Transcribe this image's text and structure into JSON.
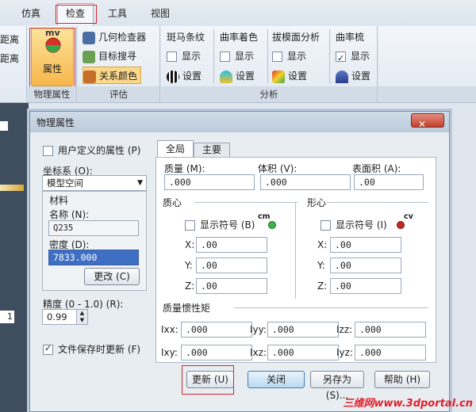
{
  "tabs": [
    "仿真",
    "检查",
    "工具",
    "视图"
  ],
  "ribbon": {
    "left_fragments": [
      "距离",
      "距离"
    ],
    "physical": {
      "label": "属性",
      "mv": "mv",
      "group": "物理属性"
    },
    "evaluate": {
      "items": [
        "几何检查器",
        "目标搜寻",
        "关系颜色"
      ],
      "group": "评估"
    },
    "zebra": {
      "title": "斑马条纹",
      "show": "显示",
      "settings": "设置"
    },
    "curv_color": {
      "title": "曲率着色",
      "show": "显示",
      "settings": "设置"
    },
    "draft": {
      "title": "拔模面分析",
      "show": "显示",
      "settings": "设置"
    },
    "comb": {
      "title": "曲率梳",
      "show": "显示",
      "settings": "设置"
    },
    "analysis_group": "分析"
  },
  "left_strip": {
    "value": "1"
  },
  "dialog": {
    "title": "物理属性",
    "close": "✕",
    "user_defined": "用户定义的属性 (P)",
    "coord_label": "坐标系 (O):",
    "coord_value": "模型空间",
    "material_title": "材料",
    "name_label": "名称 (N):",
    "name_value": "Q235",
    "density_label": "密度 (D):",
    "density_value": "7833.000",
    "change_button": "更改 (C)",
    "precision_label": "精度 (0 - 1.0) (R):",
    "precision_value": "0.99",
    "update_on_save": "文件保存时更新 (F)",
    "tab_global": "全局",
    "tab_main": "主要",
    "mass_label": "质量 (M):",
    "mass_value": ".000",
    "volume_label": "体积 (V):",
    "volume_value": ".000",
    "area_label": "表面积 (A):",
    "area_value": ".00",
    "centroid_title": "质心",
    "centroid_show": "显示符号 (B)",
    "centroid_symbol": "cm",
    "shape_title": "形心",
    "shape_show": "显示符号 (I)",
    "shape_symbol": "cv",
    "x_label": "X:",
    "y_label": "Y:",
    "z_label": "Z:",
    "cm_x": ".00",
    "cm_y": ".00",
    "cm_z": ".00",
    "cv_x": ".00",
    "cv_y": ".00",
    "cv_z": ".00",
    "inertia_title": "质量惯性矩",
    "inertia": [
      {
        "label": "Ixx:",
        "value": ".000"
      },
      {
        "label": "Iyy:",
        "value": ".000"
      },
      {
        "label": "Izz:",
        "value": ".000"
      },
      {
        "label": "Ixy:",
        "value": ".000"
      },
      {
        "label": "Ixz:",
        "value": ".000"
      },
      {
        "label": "Iyz:",
        "value": ".000"
      }
    ],
    "btn_update": "更新 (U)",
    "btn_close": "关闭",
    "btn_saveas": "另存为 (S)...",
    "btn_help": "帮助 (H)"
  },
  "watermark": "三维网www.3dportal.cn"
}
